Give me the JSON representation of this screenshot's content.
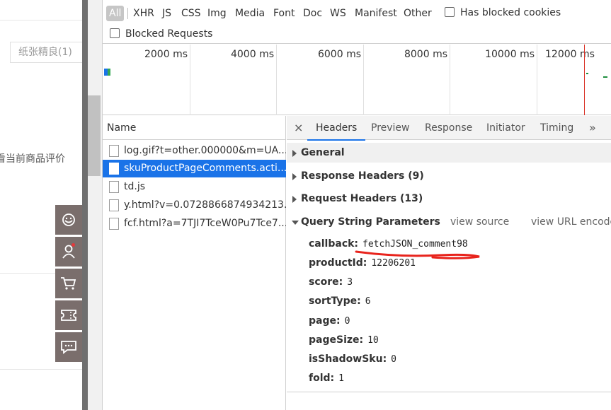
{
  "page": {
    "tag_label": "纸张精良(1)",
    "hint_text": "看当前商品评价"
  },
  "filter": {
    "types": [
      "All",
      "XHR",
      "JS",
      "CSS",
      "Img",
      "Media",
      "Font",
      "Doc",
      "WS",
      "Manifest",
      "Other"
    ],
    "has_blocked_cookies": "Has blocked cookies",
    "blocked_requests": "Blocked Requests"
  },
  "timeline": {
    "ticks": [
      "2000 ms",
      "4000 ms",
      "6000 ms",
      "8000 ms",
      "10000 ms",
      "12000 ms"
    ]
  },
  "requests": {
    "header": "Name",
    "rows": [
      "log.gif?t=other.000000&m=UA...",
      "skuProductPageComments.acti...",
      "td.js",
      "y.html?v=0.0728866874934213...",
      "fcf.html?a=7TJI7TceW0Pu7Tce7..."
    ]
  },
  "detail": {
    "close": "×",
    "tabs": [
      "Headers",
      "Preview",
      "Response",
      "Initiator",
      "Timing",
      "»"
    ],
    "sections": {
      "general": "General",
      "response_headers": "Response Headers (9)",
      "request_headers": "Request Headers (13)",
      "query_string": "Query String Parameters",
      "view_source": "view source",
      "view_url_encoded": "view URL encoded"
    },
    "params": [
      {
        "key": "callback:",
        "value": "fetchJSON_comment98"
      },
      {
        "key": "productId:",
        "value": "12206201"
      },
      {
        "key": "score:",
        "value": "3"
      },
      {
        "key": "sortType:",
        "value": "6"
      },
      {
        "key": "page:",
        "value": "0"
      },
      {
        "key": "pageSize:",
        "value": "10"
      },
      {
        "key": "isShadowSku:",
        "value": "0"
      },
      {
        "key": "fold:",
        "value": "1"
      }
    ]
  },
  "colors": {
    "selected_row": "#1a73e8",
    "annotation_underline": "#e8231c",
    "timeline_marker": "#d93025"
  }
}
